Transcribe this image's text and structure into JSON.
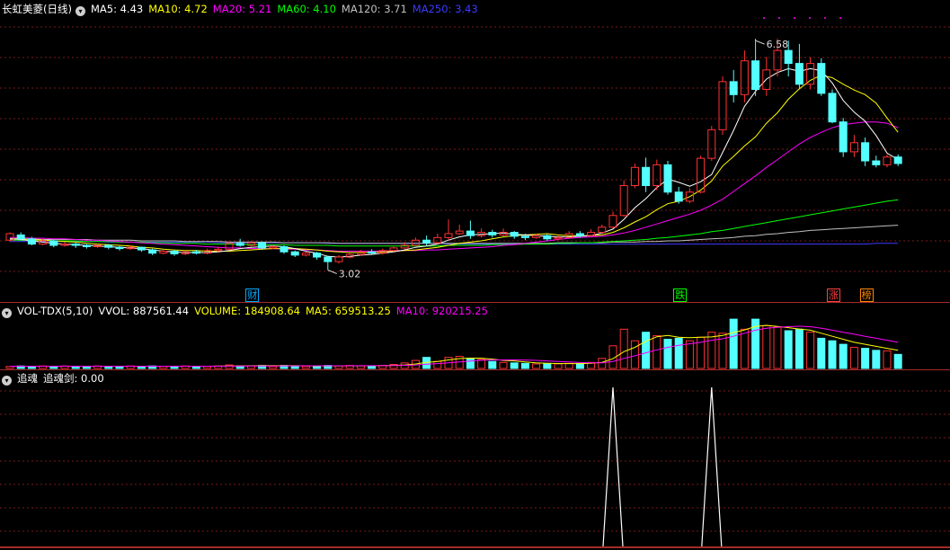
{
  "colors": {
    "up": "#ff3232",
    "down": "#54ffff",
    "grid": "#7a1a1a",
    "frame": "#a52a2a",
    "ma5": "#ffffff",
    "ma10": "#ffff00",
    "ma20": "#ff00ff",
    "ma60": "#00ff00",
    "ma120": "#c0c0c0",
    "ma250": "#3b3bff"
  },
  "main": {
    "title": "长虹美菱(日线)",
    "indicators": [
      {
        "text": "MA5: 4.43",
        "color": "#ffffff"
      },
      {
        "text": "MA10: 4.72",
        "color": "#ffff00"
      },
      {
        "text": "MA20: 5.21",
        "color": "#ff00ff"
      },
      {
        "text": "MA60: 4.10",
        "color": "#00ff00"
      },
      {
        "text": "MA120: 3.71",
        "color": "#c0c0c0"
      },
      {
        "text": "MA250: 3.43",
        "color": "#3b3bff"
      }
    ],
    "high_label": "6.58",
    "low_label": "3.02",
    "markers": [
      {
        "text": "财",
        "color": "#00aaff"
      },
      {
        "text": "跌",
        "color": "#00ff00"
      },
      {
        "text": "涨",
        "color": "#ff4040"
      },
      {
        "text": "榜",
        "color": "#ff8800"
      }
    ]
  },
  "volume": {
    "title": "VOL-TDX(5,10)",
    "indicators": [
      {
        "text": "VVOL: 887561.44",
        "color": "#ffffff"
      },
      {
        "text": "VOLUME: 184908.64",
        "color": "#ffff00"
      },
      {
        "text": "MA5: 659513.25",
        "color": "#ffff00"
      },
      {
        "text": "MA10: 920215.25",
        "color": "#ff00ff"
      }
    ]
  },
  "indicator": {
    "title": "追魂",
    "indicators": [
      {
        "text": "追魂剑: 0.00",
        "color": "#ffffff"
      }
    ]
  },
  "chart_data": {
    "type": "candlestick",
    "high": 6.58,
    "low": 3.02,
    "ylim": [
      2.75,
      6.9
    ],
    "candles": [
      [
        3.48,
        3.58,
        3.46,
        3.6
      ],
      [
        3.56,
        3.5,
        3.47,
        3.6
      ],
      [
        3.5,
        3.42,
        3.4,
        3.53
      ],
      [
        3.42,
        3.47,
        3.4,
        3.5
      ],
      [
        3.47,
        3.4,
        3.37,
        3.49
      ],
      [
        3.4,
        3.42,
        3.38,
        3.45
      ],
      [
        3.42,
        3.4,
        3.36,
        3.44
      ],
      [
        3.4,
        3.38,
        3.35,
        3.42
      ],
      [
        3.38,
        3.4,
        3.36,
        3.42
      ],
      [
        3.4,
        3.37,
        3.34,
        3.42
      ],
      [
        3.37,
        3.35,
        3.32,
        3.39
      ],
      [
        3.35,
        3.37,
        3.33,
        3.4
      ],
      [
        3.37,
        3.33,
        3.3,
        3.38
      ],
      [
        3.33,
        3.28,
        3.25,
        3.35
      ],
      [
        3.28,
        3.31,
        3.26,
        3.33
      ],
      [
        3.31,
        3.27,
        3.24,
        3.33
      ],
      [
        3.27,
        3.3,
        3.25,
        3.32
      ],
      [
        3.3,
        3.28,
        3.26,
        3.33
      ],
      [
        3.28,
        3.32,
        3.26,
        3.35
      ],
      [
        3.32,
        3.34,
        3.3,
        3.38
      ],
      [
        3.34,
        3.43,
        3.32,
        3.46
      ],
      [
        3.43,
        3.4,
        3.38,
        3.5
      ],
      [
        3.4,
        3.44,
        3.38,
        3.47
      ],
      [
        3.44,
        3.36,
        3.33,
        3.46
      ],
      [
        3.36,
        3.38,
        3.34,
        3.4
      ],
      [
        3.38,
        3.3,
        3.27,
        3.4
      ],
      [
        3.3,
        3.25,
        3.22,
        3.32
      ],
      [
        3.25,
        3.28,
        3.23,
        3.3
      ],
      [
        3.28,
        3.22,
        3.18,
        3.3
      ],
      [
        3.22,
        3.15,
        3.02,
        3.24
      ],
      [
        3.15,
        3.22,
        3.12,
        3.25
      ],
      [
        3.22,
        3.26,
        3.2,
        3.28
      ],
      [
        3.26,
        3.3,
        3.24,
        3.33
      ],
      [
        3.3,
        3.28,
        3.26,
        3.34
      ],
      [
        3.28,
        3.32,
        3.26,
        3.35
      ],
      [
        3.32,
        3.36,
        3.3,
        3.38
      ],
      [
        3.36,
        3.4,
        3.34,
        3.45
      ],
      [
        3.4,
        3.48,
        3.38,
        3.52
      ],
      [
        3.48,
        3.44,
        3.4,
        3.55
      ],
      [
        3.44,
        3.52,
        3.42,
        3.58
      ],
      [
        3.52,
        3.58,
        3.48,
        3.8
      ],
      [
        3.58,
        3.62,
        3.56,
        3.72
      ],
      [
        3.62,
        3.55,
        3.5,
        3.78
      ],
      [
        3.55,
        3.6,
        3.52,
        3.66
      ],
      [
        3.6,
        3.56,
        3.52,
        3.64
      ],
      [
        3.56,
        3.6,
        3.54,
        3.66
      ],
      [
        3.6,
        3.54,
        3.5,
        3.62
      ],
      [
        3.54,
        3.52,
        3.48,
        3.58
      ],
      [
        3.52,
        3.55,
        3.5,
        3.58
      ],
      [
        3.55,
        3.5,
        3.47,
        3.57
      ],
      [
        3.5,
        3.52,
        3.48,
        3.56
      ],
      [
        3.52,
        3.58,
        3.5,
        3.62
      ],
      [
        3.58,
        3.55,
        3.52,
        3.62
      ],
      [
        3.55,
        3.6,
        3.53,
        3.65
      ],
      [
        3.6,
        3.68,
        3.58,
        3.72
      ],
      [
        3.68,
        3.86,
        3.66,
        3.92
      ],
      [
        3.86,
        4.32,
        3.84,
        4.4
      ],
      [
        4.32,
        4.6,
        4.28,
        4.66
      ],
      [
        4.6,
        4.32,
        4.22,
        4.75
      ],
      [
        4.32,
        4.64,
        4.25,
        4.72
      ],
      [
        4.64,
        4.22,
        4.18,
        4.7
      ],
      [
        4.22,
        4.08,
        4.04,
        4.3
      ],
      [
        4.08,
        4.22,
        4.05,
        4.28
      ],
      [
        4.22,
        4.74,
        4.2,
        4.78
      ],
      [
        4.74,
        5.18,
        4.7,
        5.24
      ],
      [
        5.18,
        5.92,
        5.1,
        6.0
      ],
      [
        5.92,
        5.72,
        5.6,
        6.1
      ],
      [
        5.72,
        6.24,
        5.6,
        6.4
      ],
      [
        6.24,
        5.8,
        5.7,
        6.58
      ],
      [
        5.8,
        6.1,
        5.7,
        6.3
      ],
      [
        6.1,
        6.4,
        6.0,
        6.58
      ],
      [
        6.4,
        6.2,
        6.0,
        6.55
      ],
      [
        6.2,
        5.88,
        5.8,
        6.5
      ],
      [
        5.88,
        6.2,
        5.8,
        6.3
      ],
      [
        6.2,
        5.74,
        5.7,
        6.28
      ],
      [
        5.74,
        5.3,
        5.28,
        5.8
      ],
      [
        5.3,
        4.84,
        4.76,
        5.36
      ],
      [
        4.84,
        4.98,
        4.76,
        5.1
      ],
      [
        4.98,
        4.7,
        4.62,
        5.06
      ],
      [
        4.7,
        4.64,
        4.6,
        4.78
      ],
      [
        4.64,
        4.76,
        4.6,
        4.8
      ],
      [
        4.76,
        4.66,
        4.62,
        4.8
      ]
    ],
    "ma5": [
      3.5,
      3.49,
      3.47,
      3.45,
      3.43,
      3.42,
      3.41,
      3.4,
      3.39,
      3.38,
      3.37,
      3.36,
      3.35,
      3.33,
      3.31,
      3.3,
      3.29,
      3.29,
      3.29,
      3.3,
      3.32,
      3.35,
      3.37,
      3.38,
      3.39,
      3.38,
      3.35,
      3.31,
      3.28,
      3.23,
      3.22,
      3.23,
      3.25,
      3.26,
      3.28,
      3.3,
      3.33,
      3.37,
      3.39,
      3.42,
      3.48,
      3.53,
      3.56,
      3.57,
      3.58,
      3.59,
      3.57,
      3.56,
      3.55,
      3.54,
      3.53,
      3.53,
      3.54,
      3.55,
      3.59,
      3.65,
      3.8,
      3.98,
      4.12,
      4.29,
      4.42,
      4.37,
      4.31,
      4.38,
      4.49,
      4.83,
      5.17,
      5.54,
      5.77,
      5.96,
      6.06,
      6.12,
      6.08,
      6.12,
      6.09,
      5.9,
      5.63,
      5.45,
      5.31,
      5.09,
      4.82,
      4.72
    ],
    "ma10": [
      3.5,
      3.5,
      3.49,
      3.48,
      3.47,
      3.46,
      3.45,
      3.43,
      3.42,
      3.41,
      3.4,
      3.39,
      3.37,
      3.36,
      3.34,
      3.33,
      3.32,
      3.32,
      3.31,
      3.31,
      3.31,
      3.32,
      3.33,
      3.34,
      3.35,
      3.35,
      3.35,
      3.34,
      3.33,
      3.31,
      3.3,
      3.29,
      3.29,
      3.29,
      3.3,
      3.31,
      3.32,
      3.33,
      3.35,
      3.37,
      3.4,
      3.43,
      3.45,
      3.47,
      3.5,
      3.53,
      3.55,
      3.56,
      3.57,
      3.58,
      3.56,
      3.55,
      3.55,
      3.55,
      3.56,
      3.6,
      3.67,
      3.76,
      3.84,
      3.95,
      4.04,
      4.08,
      4.15,
      4.25,
      4.39,
      4.62,
      4.77,
      4.93,
      5.07,
      5.28,
      5.44,
      5.65,
      5.81,
      5.94,
      6.02,
      5.98,
      5.88,
      5.79,
      5.72,
      5.59,
      5.36,
      5.14
    ],
    "ma20": [
      3.52,
      3.52,
      3.51,
      3.51,
      3.5,
      3.5,
      3.49,
      3.48,
      3.48,
      3.47,
      3.46,
      3.45,
      3.44,
      3.43,
      3.42,
      3.41,
      3.4,
      3.39,
      3.38,
      3.37,
      3.36,
      3.36,
      3.35,
      3.35,
      3.35,
      3.34,
      3.34,
      3.33,
      3.33,
      3.32,
      3.31,
      3.31,
      3.31,
      3.31,
      3.31,
      3.32,
      3.32,
      3.32,
      3.33,
      3.33,
      3.34,
      3.35,
      3.36,
      3.37,
      3.38,
      3.4,
      3.41,
      3.43,
      3.45,
      3.47,
      3.49,
      3.51,
      3.52,
      3.53,
      3.54,
      3.56,
      3.59,
      3.63,
      3.68,
      3.73,
      3.78,
      3.83,
      3.88,
      3.94,
      4.02,
      4.11,
      4.23,
      4.35,
      4.47,
      4.6,
      4.72,
      4.84,
      4.96,
      5.06,
      5.14,
      5.21,
      5.26,
      5.28,
      5.3,
      5.3,
      5.28,
      5.21
    ],
    "ma60": [
      3.48,
      3.48,
      3.48,
      3.48,
      3.47,
      3.47,
      3.47,
      3.46,
      3.46,
      3.46,
      3.45,
      3.45,
      3.45,
      3.44,
      3.44,
      3.43,
      3.43,
      3.43,
      3.42,
      3.42,
      3.42,
      3.42,
      3.41,
      3.41,
      3.41,
      3.41,
      3.4,
      3.4,
      3.4,
      3.4,
      3.39,
      3.39,
      3.39,
      3.39,
      3.39,
      3.39,
      3.39,
      3.39,
      3.39,
      3.39,
      3.4,
      3.4,
      3.4,
      3.4,
      3.41,
      3.41,
      3.41,
      3.42,
      3.42,
      3.42,
      3.43,
      3.43,
      3.44,
      3.44,
      3.45,
      3.46,
      3.47,
      3.48,
      3.49,
      3.51,
      3.52,
      3.54,
      3.56,
      3.58,
      3.61,
      3.63,
      3.66,
      3.69,
      3.72,
      3.75,
      3.78,
      3.81,
      3.84,
      3.87,
      3.9,
      3.93,
      3.96,
      3.99,
      4.02,
      4.05,
      4.08,
      4.1
    ],
    "ma120": [
      3.5,
      3.5,
      3.5,
      3.49,
      3.49,
      3.49,
      3.49,
      3.49,
      3.48,
      3.48,
      3.48,
      3.48,
      3.47,
      3.47,
      3.47,
      3.47,
      3.46,
      3.46,
      3.46,
      3.46,
      3.45,
      3.45,
      3.45,
      3.45,
      3.45,
      3.44,
      3.44,
      3.44,
      3.44,
      3.44,
      3.43,
      3.43,
      3.43,
      3.43,
      3.43,
      3.43,
      3.43,
      3.43,
      3.43,
      3.43,
      3.43,
      3.43,
      3.43,
      3.43,
      3.43,
      3.43,
      3.43,
      3.43,
      3.43,
      3.43,
      3.44,
      3.44,
      3.44,
      3.44,
      3.44,
      3.45,
      3.45,
      3.45,
      3.46,
      3.46,
      3.47,
      3.47,
      3.48,
      3.49,
      3.5,
      3.51,
      3.52,
      3.54,
      3.55,
      3.57,
      3.58,
      3.6,
      3.61,
      3.63,
      3.64,
      3.65,
      3.66,
      3.67,
      3.68,
      3.69,
      3.7,
      3.71
    ],
    "ma250": [
      3.46,
      3.46,
      3.46,
      3.46,
      3.46,
      3.46,
      3.46,
      3.46,
      3.46,
      3.45,
      3.45,
      3.45,
      3.45,
      3.45,
      3.45,
      3.45,
      3.45,
      3.45,
      3.45,
      3.44,
      3.44,
      3.44,
      3.44,
      3.44,
      3.44,
      3.44,
      3.44,
      3.44,
      3.44,
      3.43,
      3.43,
      3.43,
      3.43,
      3.43,
      3.43,
      3.43,
      3.43,
      3.43,
      3.43,
      3.43,
      3.42,
      3.42,
      3.42,
      3.42,
      3.42,
      3.42,
      3.42,
      3.42,
      3.42,
      3.42,
      3.42,
      3.42,
      3.42,
      3.42,
      3.42,
      3.42,
      3.42,
      3.42,
      3.42,
      3.42,
      3.42,
      3.42,
      3.42,
      3.42,
      3.42,
      3.42,
      3.42,
      3.42,
      3.42,
      3.42,
      3.42,
      3.42,
      3.42,
      3.42,
      3.42,
      3.42,
      3.42,
      3.42,
      3.42,
      3.43,
      3.43,
      3.43
    ],
    "volume": [
      0.04,
      0.05,
      0.04,
      0.05,
      0.04,
      0.05,
      0.04,
      0.04,
      0.05,
      0.04,
      0.04,
      0.05,
      0.04,
      0.05,
      0.04,
      0.04,
      0.05,
      0.04,
      0.04,
      0.05,
      0.07,
      0.05,
      0.05,
      0.06,
      0.04,
      0.06,
      0.05,
      0.04,
      0.05,
      0.06,
      0.05,
      0.06,
      0.05,
      0.05,
      0.06,
      0.08,
      0.11,
      0.16,
      0.22,
      0.14,
      0.22,
      0.24,
      0.2,
      0.18,
      0.14,
      0.12,
      0.11,
      0.1,
      0.09,
      0.1,
      0.09,
      0.1,
      0.1,
      0.12,
      0.2,
      0.45,
      0.78,
      0.55,
      0.72,
      0.65,
      0.58,
      0.6,
      0.55,
      0.62,
      0.72,
      0.7,
      0.98,
      0.78,
      0.98,
      0.85,
      0.82,
      0.75,
      0.78,
      0.72,
      0.6,
      0.55,
      0.48,
      0.42,
      0.4,
      0.36,
      0.35,
      0.28
    ],
    "vol_ma5": [
      0.045,
      0.045,
      0.045,
      0.045,
      0.045,
      0.045,
      0.045,
      0.045,
      0.045,
      0.045,
      0.045,
      0.045,
      0.045,
      0.045,
      0.045,
      0.045,
      0.045,
      0.045,
      0.045,
      0.046,
      0.05,
      0.052,
      0.053,
      0.056,
      0.055,
      0.056,
      0.055,
      0.054,
      0.05,
      0.053,
      0.052,
      0.052,
      0.054,
      0.054,
      0.056,
      0.06,
      0.07,
      0.09,
      0.12,
      0.14,
      0.17,
      0.196,
      0.206,
      0.204,
      0.186,
      0.16,
      0.15,
      0.13,
      0.112,
      0.104,
      0.098,
      0.096,
      0.096,
      0.102,
      0.122,
      0.194,
      0.334,
      0.42,
      0.54,
      0.63,
      0.656,
      0.62,
      0.61,
      0.62,
      0.626,
      0.656,
      0.714,
      0.766,
      0.834,
      0.858,
      0.834,
      0.81,
      0.784,
      0.76,
      0.7,
      0.64,
      0.58,
      0.52,
      0.48,
      0.44,
      0.4,
      0.362
    ],
    "vol_ma10": [
      0.045,
      0.045,
      0.045,
      0.045,
      0.045,
      0.045,
      0.045,
      0.045,
      0.045,
      0.045,
      0.045,
      0.045,
      0.045,
      0.045,
      0.045,
      0.045,
      0.045,
      0.045,
      0.045,
      0.045,
      0.047,
      0.048,
      0.049,
      0.05,
      0.05,
      0.051,
      0.052,
      0.053,
      0.053,
      0.054,
      0.054,
      0.054,
      0.055,
      0.055,
      0.056,
      0.058,
      0.062,
      0.07,
      0.085,
      0.097,
      0.113,
      0.13,
      0.148,
      0.163,
      0.17,
      0.17,
      0.17,
      0.168,
      0.16,
      0.15,
      0.138,
      0.128,
      0.118,
      0.112,
      0.112,
      0.14,
      0.2,
      0.252,
      0.31,
      0.37,
      0.42,
      0.46,
      0.49,
      0.52,
      0.56,
      0.59,
      0.64,
      0.7,
      0.76,
      0.8,
      0.82,
      0.83,
      0.84,
      0.83,
      0.8,
      0.76,
      0.72,
      0.68,
      0.64,
      0.6,
      0.56,
      0.52
    ],
    "signal_peaks": [
      55,
      64
    ]
  }
}
